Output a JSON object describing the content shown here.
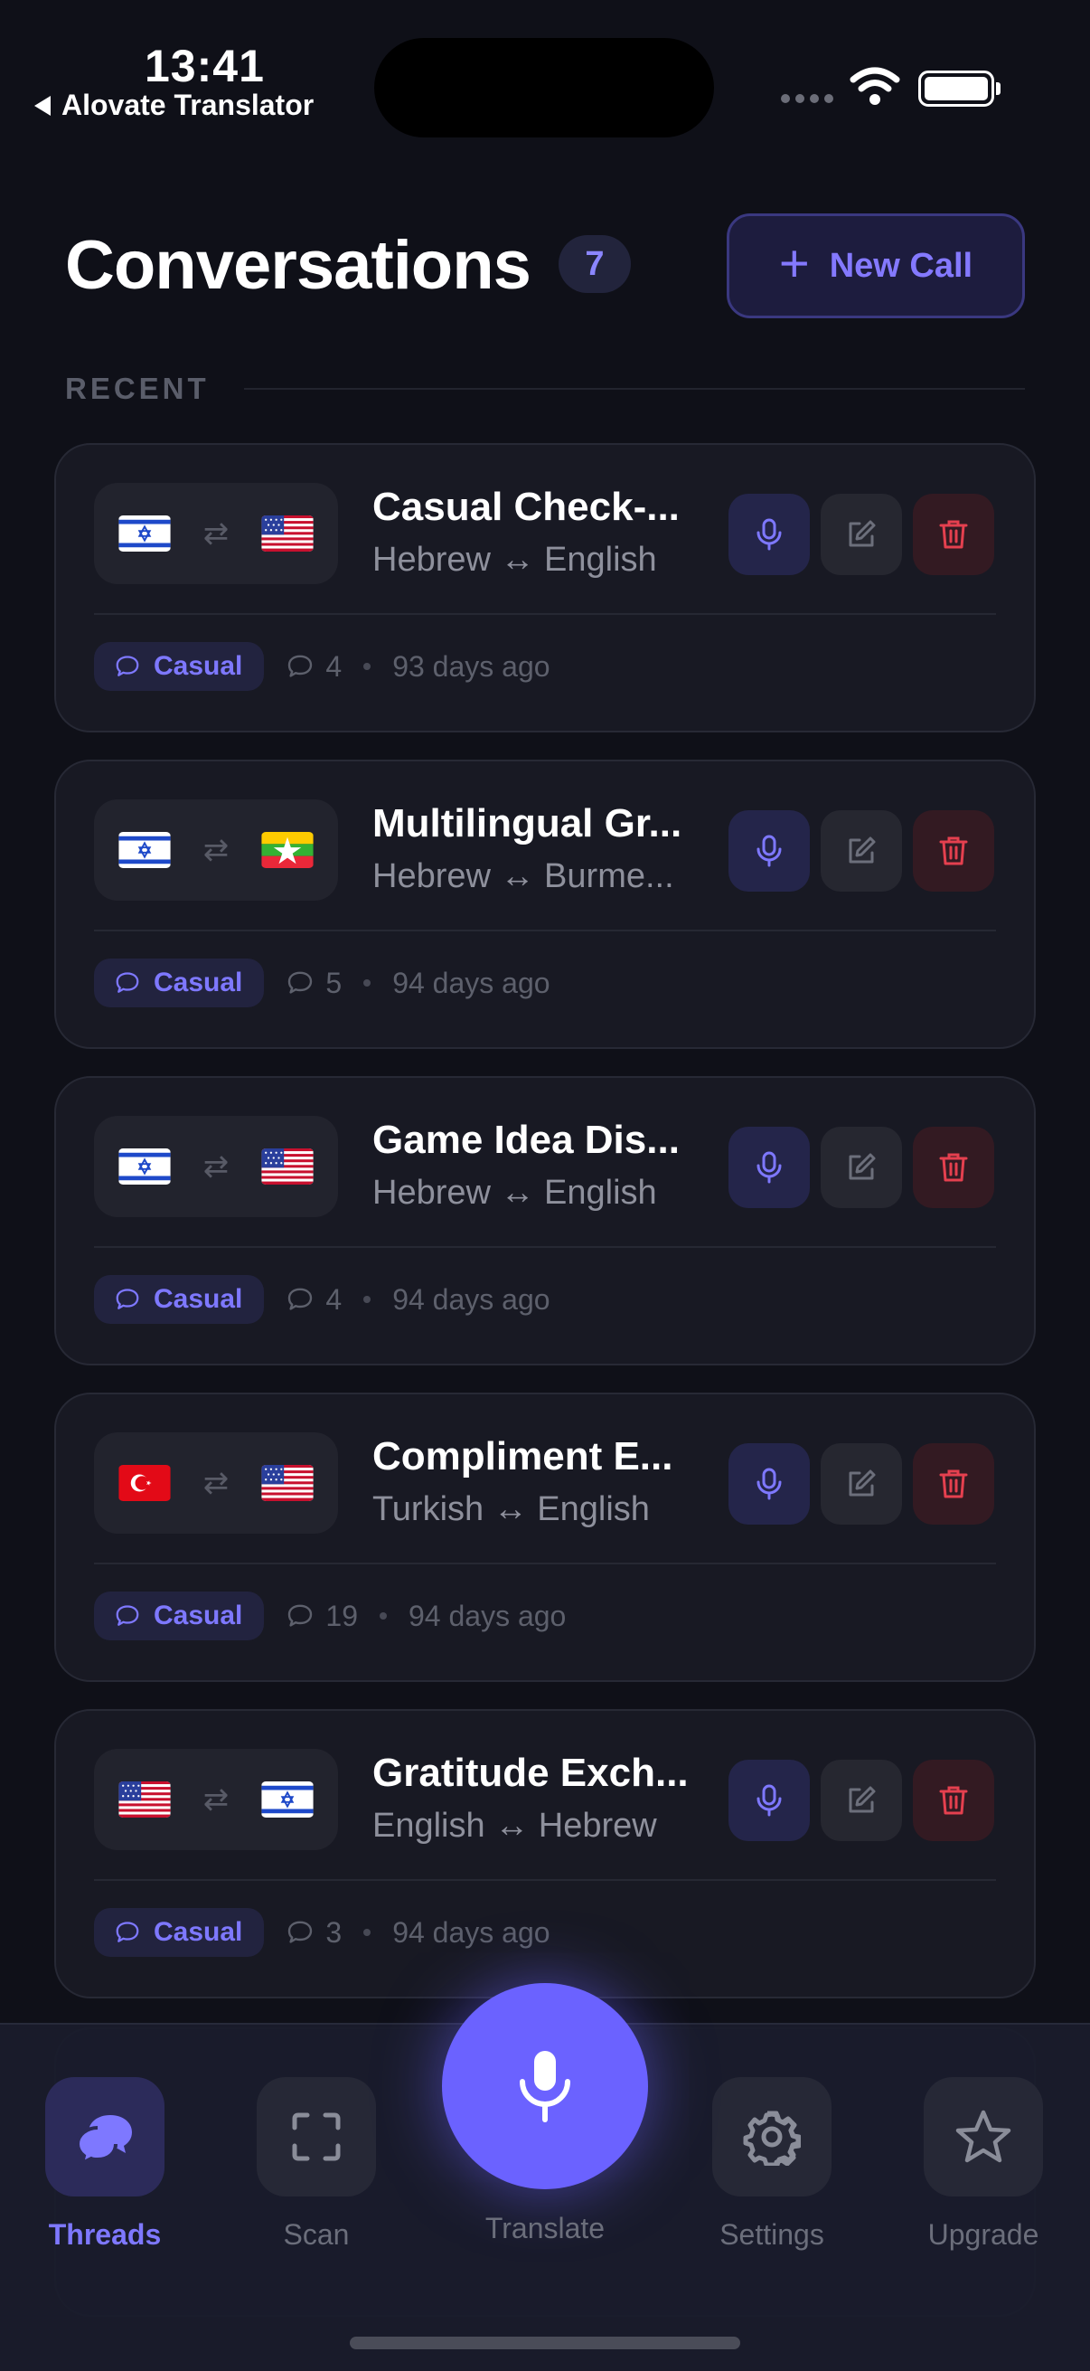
{
  "status": {
    "time": "13:41",
    "back_label": "Alovate Translator"
  },
  "header": {
    "title": "Conversations",
    "count": "7",
    "new_call_label": "New Call"
  },
  "section": {
    "label": "RECENT"
  },
  "conversations": [
    {
      "title": "Casual Check-...",
      "langs": "Hebrew ↔ English",
      "tag": "Casual",
      "messages": "4",
      "time": "93 days ago",
      "flag_from": "israel-flag",
      "flag_to": "usa-flag"
    },
    {
      "title": "Multilingual Gr...",
      "langs": "Hebrew ↔ Burme...",
      "tag": "Casual",
      "messages": "5",
      "time": "94 days ago",
      "flag_from": "israel-flag",
      "flag_to": "myanmar-flag"
    },
    {
      "title": "Game Idea Dis...",
      "langs": "Hebrew ↔ English",
      "tag": "Casual",
      "messages": "4",
      "time": "94 days ago",
      "flag_from": "israel-flag",
      "flag_to": "usa-flag"
    },
    {
      "title": "Compliment E...",
      "langs": "Turkish ↔ English",
      "tag": "Casual",
      "messages": "19",
      "time": "94 days ago",
      "flag_from": "turkey-flag",
      "flag_to": "usa-flag"
    },
    {
      "title": "Gratitude Exch...",
      "langs": "English ↔ Hebrew",
      "tag": "Casual",
      "messages": "3",
      "time": "94 days ago",
      "flag_from": "usa-flag",
      "flag_to": "israel-flag"
    }
  ],
  "tabs": [
    {
      "label": "Threads",
      "icon": "chat-bubbles-icon",
      "active": true
    },
    {
      "label": "Scan",
      "icon": "scan-frame-icon",
      "active": false
    },
    {
      "label": "Translate",
      "icon": "microphone-icon",
      "active": false
    },
    {
      "label": "Settings",
      "icon": "gear-icon",
      "active": false
    },
    {
      "label": "Upgrade",
      "icon": "star-icon",
      "active": false
    }
  ],
  "colors": {
    "accent": "#6b62ff",
    "background": "#0f1018",
    "card": "#181923",
    "danger": "#e5404f"
  }
}
